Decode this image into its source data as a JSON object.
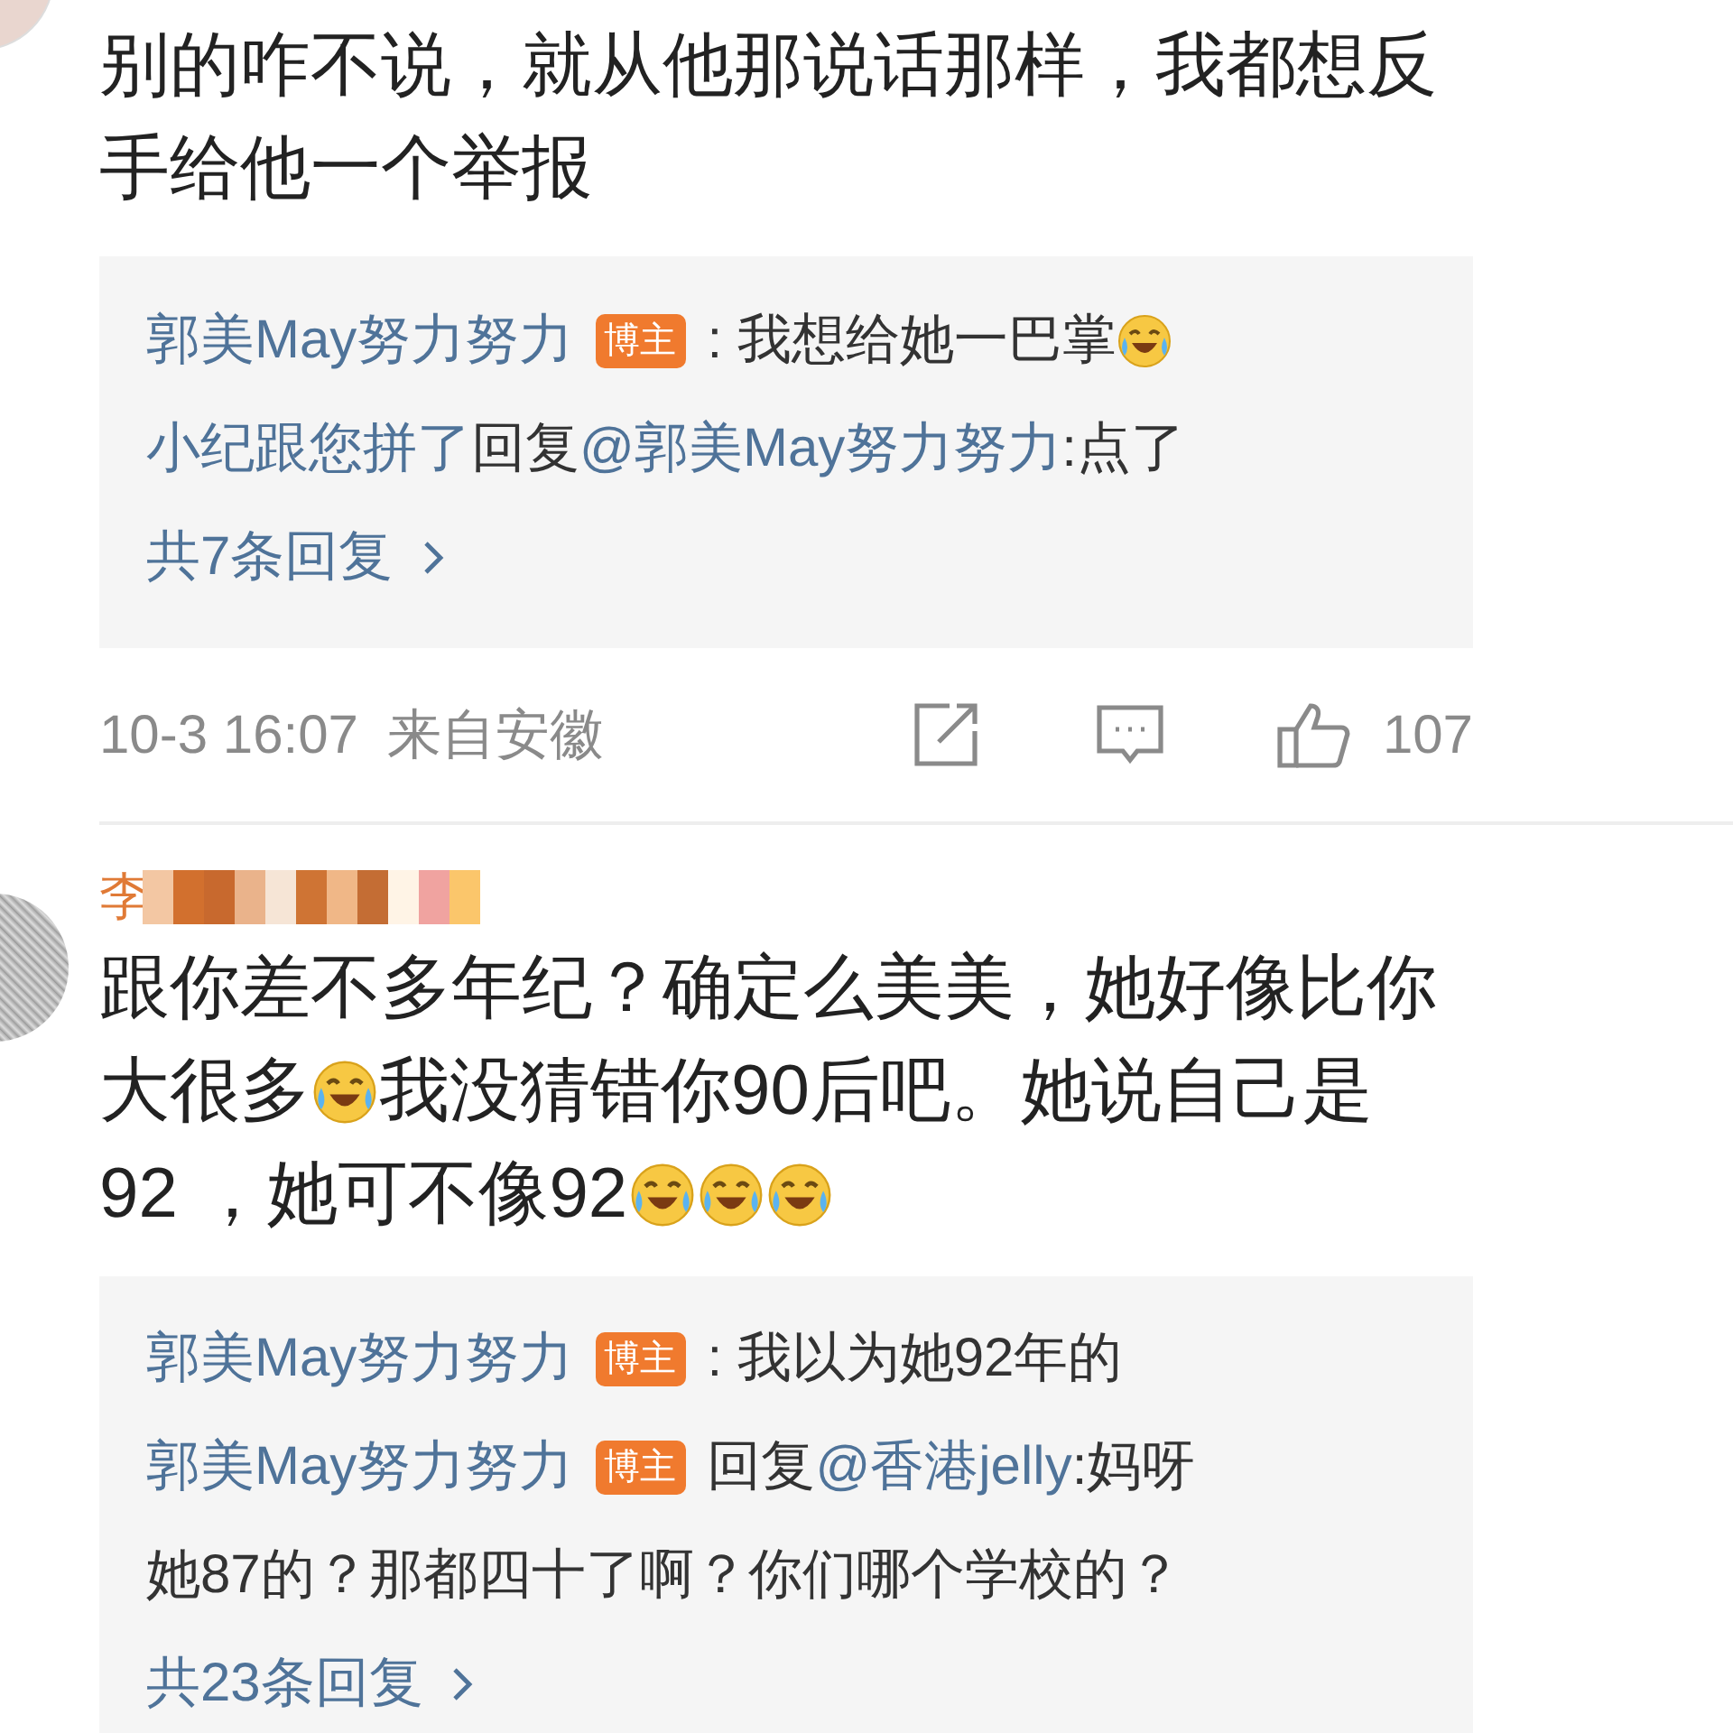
{
  "comments": [
    {
      "lines": [
        [
          {
            "kind": "text",
            "text": "别的咋不说，就从他那说话那样，我都想反"
          }
        ],
        [
          {
            "kind": "text",
            "text": "手给他一个举报"
          }
        ]
      ],
      "replies": [
        {
          "lines": [
            [
              {
                "kind": "name",
                "text": "郭美May努力努力"
              },
              {
                "kind": "badge",
                "text": "博主"
              },
              {
                "kind": "text",
                "text": ": 我想给她一巴掌"
              },
              {
                "kind": "emoji"
              }
            ]
          ]
        },
        {
          "lines": [
            [
              {
                "kind": "name",
                "text": "小纪跟您拼了"
              },
              {
                "kind": "text",
                "text": "回复"
              },
              {
                "kind": "mention",
                "text": "@郭美May努力努力"
              },
              {
                "kind": "text",
                "text": ":点了"
              }
            ]
          ]
        }
      ],
      "more": "共7条回复",
      "footer": {
        "time": "10-3 16:07",
        "location": "来自安徽",
        "likes": "107"
      }
    },
    {
      "author": "李",
      "lines": [
        [
          {
            "kind": "text",
            "text": "跟你差不多年纪？确定么美美，她好像比你"
          }
        ],
        [
          {
            "kind": "text",
            "text": "大很多"
          },
          {
            "kind": "emoji"
          },
          {
            "kind": "text",
            "text": "我没猜错你90后吧。她说自己是"
          }
        ],
        [
          {
            "kind": "text",
            "text": "92 ，她可不像92"
          },
          {
            "kind": "emoji"
          },
          {
            "kind": "emoji"
          },
          {
            "kind": "emoji"
          }
        ]
      ],
      "replies": [
        {
          "lines": [
            [
              {
                "kind": "name",
                "text": "郭美May努力努力"
              },
              {
                "kind": "badge",
                "text": "博主"
              },
              {
                "kind": "text",
                "text": ": 我以为她92年的"
              }
            ]
          ]
        },
        {
          "lines": [
            [
              {
                "kind": "name",
                "text": "郭美May努力努力"
              },
              {
                "kind": "badge",
                "text": "博主"
              },
              {
                "kind": "text",
                "text": "回复"
              },
              {
                "kind": "mention",
                "text": "@香港jelly"
              },
              {
                "kind": "text",
                "text": ":妈呀"
              }
            ],
            [
              {
                "kind": "text",
                "text": "她87的？那都四十了啊？你们哪个学校的？"
              }
            ]
          ]
        }
      ],
      "more": "共23条回复"
    }
  ]
}
